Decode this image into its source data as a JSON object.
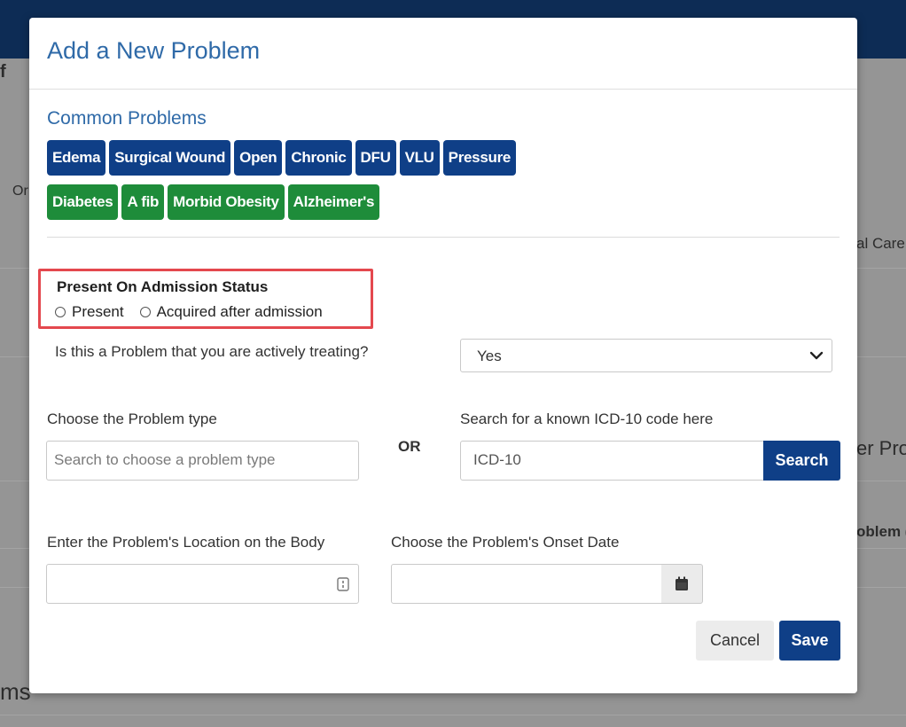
{
  "background": {
    "fragments": [
      "f",
      "Or",
      "al Care",
      "er Pro",
      "oblem (",
      "ms"
    ]
  },
  "modal": {
    "title": "Add a New Problem",
    "common_problems": {
      "title": "Common Problems",
      "row1": [
        "Edema",
        "Surgical Wound",
        "Open",
        "Chronic",
        "DFU",
        "VLU",
        "Pressure"
      ],
      "row2": [
        "Diabetes",
        "A fib",
        "Morbid Obesity",
        "Alzheimer's"
      ],
      "row1_color": "#0f3f87",
      "row2_color": "#1e8c3a"
    },
    "admission_status": {
      "title": "Present On Admission Status",
      "options": [
        "Present",
        "Acquired after admission"
      ],
      "highlight_color": "#e4484e"
    },
    "actively_treating": {
      "question": "Is this a Problem that you are actively treating?",
      "selected": "Yes"
    },
    "problem_type": {
      "label": "Choose the Problem type",
      "placeholder": "Search to choose a problem type"
    },
    "or_text": "OR",
    "icd": {
      "label": "Search for a known ICD-10 code here",
      "placeholder": "ICD-10",
      "button": "Search"
    },
    "location": {
      "label": "Enter the Problem's Location on the Body",
      "value": ""
    },
    "onset": {
      "label": "Choose the Problem's Onset Date",
      "value": ""
    },
    "buttons": {
      "cancel": "Cancel",
      "save": "Save"
    },
    "icons": [
      "chevron-down-icon",
      "list-icon",
      "calendar-icon"
    ]
  }
}
